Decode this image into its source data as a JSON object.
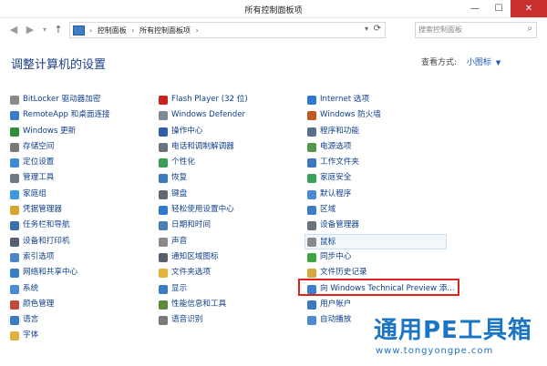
{
  "window": {
    "title": "所有控制面板项",
    "buttons": [
      "—",
      "☐",
      "✕"
    ]
  },
  "nav": {
    "back": "◀",
    "forward": "▶",
    "recent": "▾",
    "up": "↑",
    "address": {
      "crumb1": "控制面板",
      "crumb2": "所有控制面板项",
      "separator": "›",
      "dropdown": "▾",
      "refresh": "⟳"
    },
    "search": {
      "placeholder": "搜索控制面板",
      "icon": "search-icon"
    }
  },
  "main": {
    "heading": "调整计算机的设置",
    "view_by_label": "查看方式:",
    "view_by_value": "小图标",
    "view_by_caret": "▼"
  },
  "items": {
    "col1": [
      {
        "label": "BitLocker 驱动器加密",
        "color": "#8a8a8a"
      },
      {
        "label": "RemoteApp 和桌面连接",
        "color": "#3a7dc9"
      },
      {
        "label": "Windows 更新",
        "color": "#2f8f3a"
      },
      {
        "label": "存储空间",
        "color": "#7a7a7a"
      },
      {
        "label": "定位设置",
        "color": "#3d8ad6"
      },
      {
        "label": "管理工具",
        "color": "#6f7a86"
      },
      {
        "label": "家庭组",
        "color": "#3c9be0"
      },
      {
        "label": "凭据管理器",
        "color": "#d6a52b"
      },
      {
        "label": "任务栏和导航",
        "color": "#3a6fb0"
      },
      {
        "label": "设备和打印机",
        "color": "#556070"
      },
      {
        "label": "索引选项",
        "color": "#4c86c8"
      },
      {
        "label": "网络和共享中心",
        "color": "#3a7dc9"
      },
      {
        "label": "系统",
        "color": "#4a8ad4"
      },
      {
        "label": "颜色管理",
        "color": "#c04a3a"
      },
      {
        "label": "语言",
        "color": "#3b7bc4"
      },
      {
        "label": "字体",
        "color": "#e0b13a"
      }
    ],
    "col2": [
      {
        "label": "Flash Player (32 位)",
        "color": "#c8231f"
      },
      {
        "label": "Windows Defender",
        "color": "#7a8a96"
      },
      {
        "label": "操作中心",
        "color": "#2f5ea8"
      },
      {
        "label": "电话和调制解调器",
        "color": "#6a7480"
      },
      {
        "label": "个性化",
        "color": "#3a9d52"
      },
      {
        "label": "恢复",
        "color": "#3b78c0"
      },
      {
        "label": "键盘",
        "color": "#606a74"
      },
      {
        "label": "轻松使用设置中心",
        "color": "#2f7ad0"
      },
      {
        "label": "日期和时间",
        "color": "#4a7fb8"
      },
      {
        "label": "声音",
        "color": "#8a8a8a"
      },
      {
        "label": "通知区域图标",
        "color": "#556070"
      },
      {
        "label": "文件夹选项",
        "color": "#e3b43a"
      },
      {
        "label": "显示",
        "color": "#3a7dc9"
      },
      {
        "label": "性能信息和工具",
        "color": "#5a8a3a"
      },
      {
        "label": "语音识别",
        "color": "#7a7a7a"
      }
    ],
    "col3": [
      {
        "label": "Internet 选项",
        "color": "#2f7ad0"
      },
      {
        "label": "Windows 防火墙",
        "color": "#c2581e"
      },
      {
        "label": "程序和功能",
        "color": "#5a6f8a"
      },
      {
        "label": "电源选项",
        "color": "#4f9a4a"
      },
      {
        "label": "工作文件夹",
        "color": "#3b78c0"
      },
      {
        "label": "家庭安全",
        "color": "#3ba058"
      },
      {
        "label": "默认程序",
        "color": "#4a8ad4"
      },
      {
        "label": "区域",
        "color": "#3a7dc9"
      },
      {
        "label": "设备管理器",
        "color": "#6a7480"
      },
      {
        "label": "鼠标",
        "color": "#8a8a8a"
      },
      {
        "label": "同步中心",
        "color": "#3ea63e"
      },
      {
        "label": "文件历史记录",
        "color": "#d8a83a"
      },
      {
        "label": "向 Windows Technical Preview 添...",
        "color": "#3a7dc9"
      },
      {
        "label": "用户帐户",
        "color": "#3b7bc4"
      },
      {
        "label": "自动播放",
        "color": "#4a8ad4"
      }
    ]
  },
  "watermark": {
    "title": "通用PE工具箱",
    "url": "www.tongyongpe.com"
  }
}
